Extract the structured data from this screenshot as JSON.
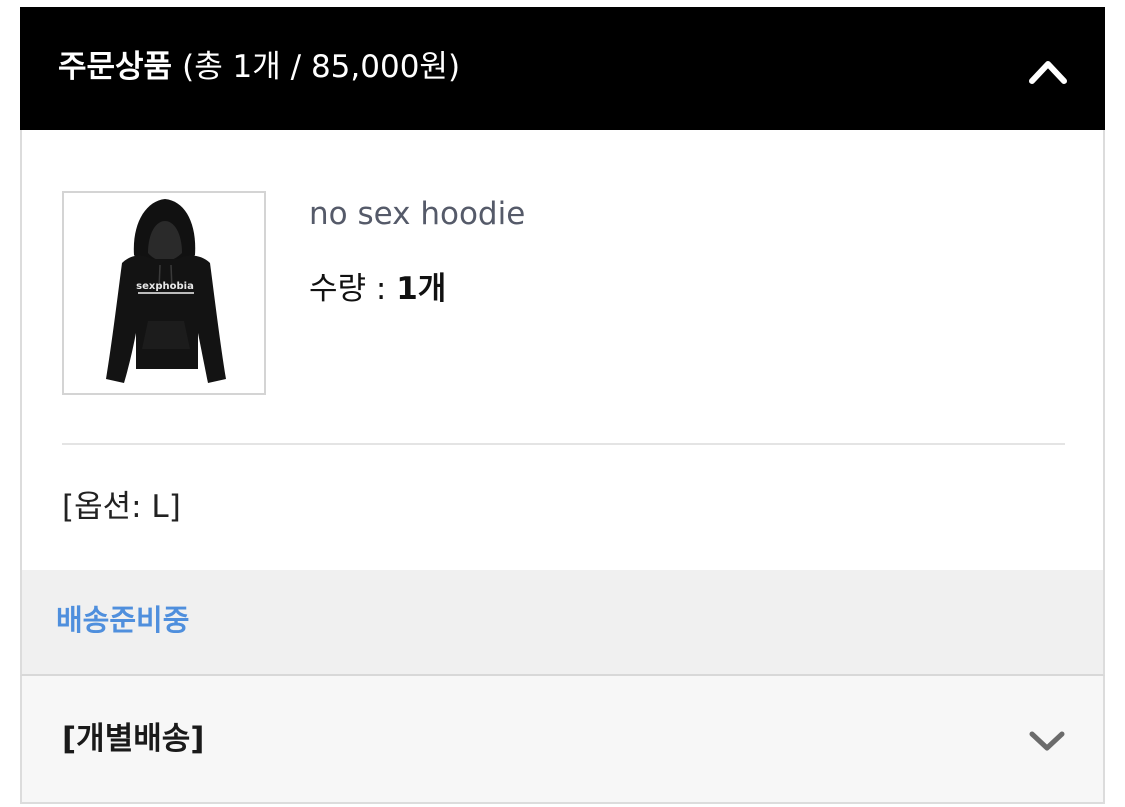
{
  "header": {
    "title": "주문상품",
    "summary": "(총 1개 / 85,000원)",
    "toggle_icon": "chevron-up-icon"
  },
  "product": {
    "name": "no sex hoodie",
    "quantity_label": "수량 : ",
    "quantity_value": "1개",
    "image_print_text": "sexphobia",
    "option": "[옵션: L]"
  },
  "status": {
    "label": "배송준비중",
    "color": "#4f8fdd"
  },
  "shipping": {
    "label": "[개별배송]",
    "expand_icon": "chevron-down-icon"
  },
  "colors": {
    "header_bg": "#000000",
    "status_bg": "#f0f0f0",
    "product_name": "#555a69"
  }
}
